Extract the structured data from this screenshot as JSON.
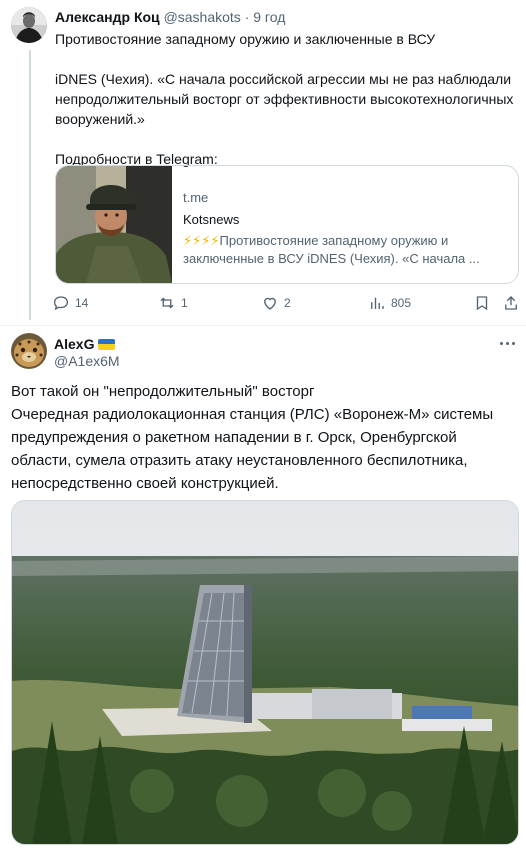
{
  "quoted_tweet": {
    "author_name": "Александр Коц",
    "meta": "@sashakots · 9 год",
    "paragraphs": [
      "Противостояние западному оружию и заключенные в ВСУ",
      "iDNES (Чехия). «С начала российской агрессии мы не раз наблюдали непродолжительный восторг от эффективности высокотехнологичных вооружений.»",
      "Подробности в Telegram:"
    ],
    "card": {
      "domain": "t.me",
      "title": "Kotsnews",
      "bolts": "⚡⚡⚡⚡",
      "description": "Противостояние западному оружию и заключенные в ВСУ iDNES (Чехия). «С начала ..."
    },
    "actions": {
      "replies": "14",
      "retweets": "1",
      "likes": "2",
      "views": "805"
    }
  },
  "main_tweet": {
    "author_name": "AlexG",
    "handle": "@A1ex6M",
    "text_lines": [
      "Вот такой он \"непродолжительный\" восторг",
      "Очередная радиолокационная станция (РЛС) «Воронеж-М» системы",
      "предупреждения о ракетном нападении в г. Орск,  Оренбургской",
      "области, сумела отразить атаку неустановленного беспилотника,",
      "непосредственно своей конструкцией."
    ]
  },
  "colors": {
    "text": "#0f1419",
    "muted": "#536471",
    "border": "#cfd9de",
    "flag_blue": "#2a6fd6",
    "flag_yellow": "#f7d117"
  },
  "icons": [
    "reply-icon",
    "retweet-icon",
    "like-icon",
    "views-icon",
    "bookmark-icon",
    "share-icon",
    "more-icon"
  ]
}
